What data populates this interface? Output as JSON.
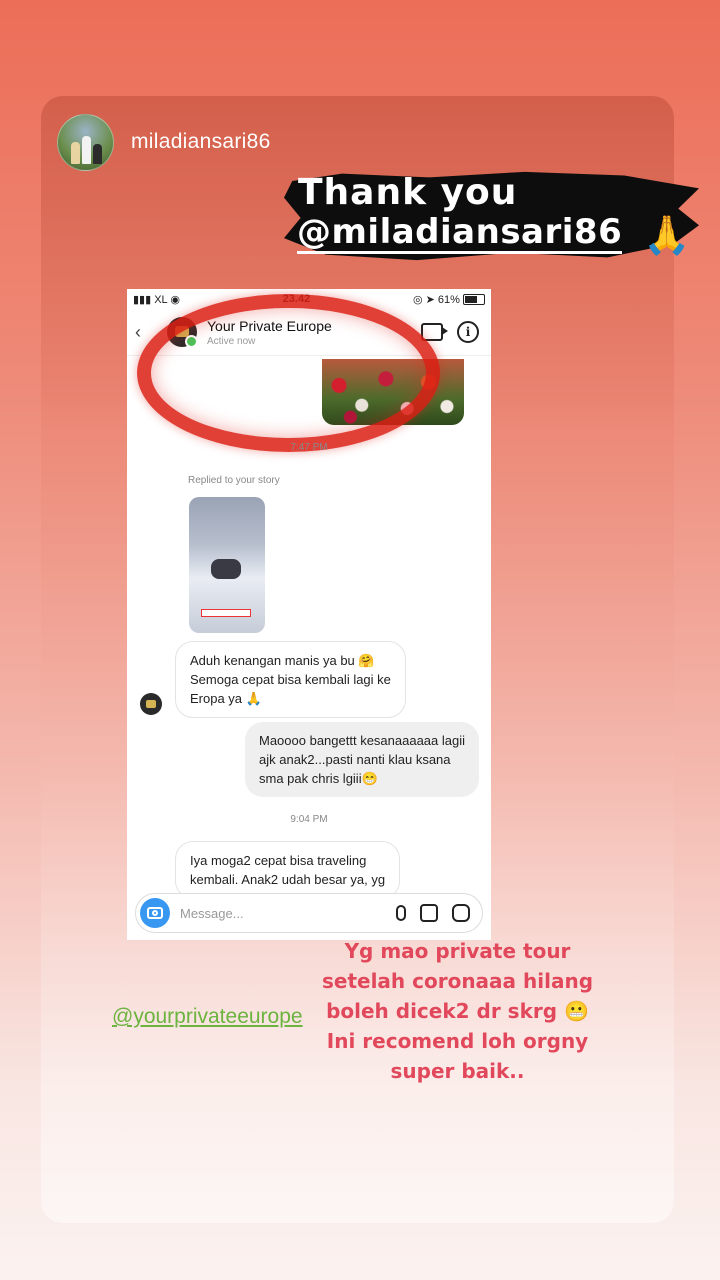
{
  "story": {
    "username": "miladiansari86",
    "thanks_line1": "Thank you",
    "thanks_line2": "@miladiansari86",
    "thanks_emoji": "🙏",
    "mention": "@yourprivateeurope",
    "caption_lines": [
      "Yg mao private tour",
      "setelah coronaaa hilang",
      "boleh dicek2 dr skrg 😬",
      "Ini recomend loh orgny",
      "super baik.."
    ]
  },
  "screenshot": {
    "status": {
      "carrier": "XL",
      "time": "23.42",
      "battery": "61%"
    },
    "chat_header": {
      "name": "Your Private Europe",
      "status": "Active now"
    },
    "time_1": "7:47 PM",
    "replied_label": "Replied to your story",
    "msg_in_1": [
      "Aduh kenangan manis ya bu 🤗",
      "Semoga cepat bisa kembali lagi ke",
      "Eropa ya 🙏"
    ],
    "msg_out_1": [
      "Maoooo bangettt kesanaaaaaa lagii",
      "ajk anak2...pasti nanti klau ksana",
      "sma pak chris lgiii😁"
    ],
    "time_2": "9:04 PM",
    "msg_in_2": [
      "Iya moga2 cepat bisa traveling",
      "kembali. Anak2 udah besar ya, yg"
    ],
    "composer_placeholder": "Message...",
    "icons": [
      "camera-icon",
      "microphone-icon",
      "gallery-icon",
      "sticker-icon",
      "video-call-icon",
      "info-icon"
    ]
  }
}
